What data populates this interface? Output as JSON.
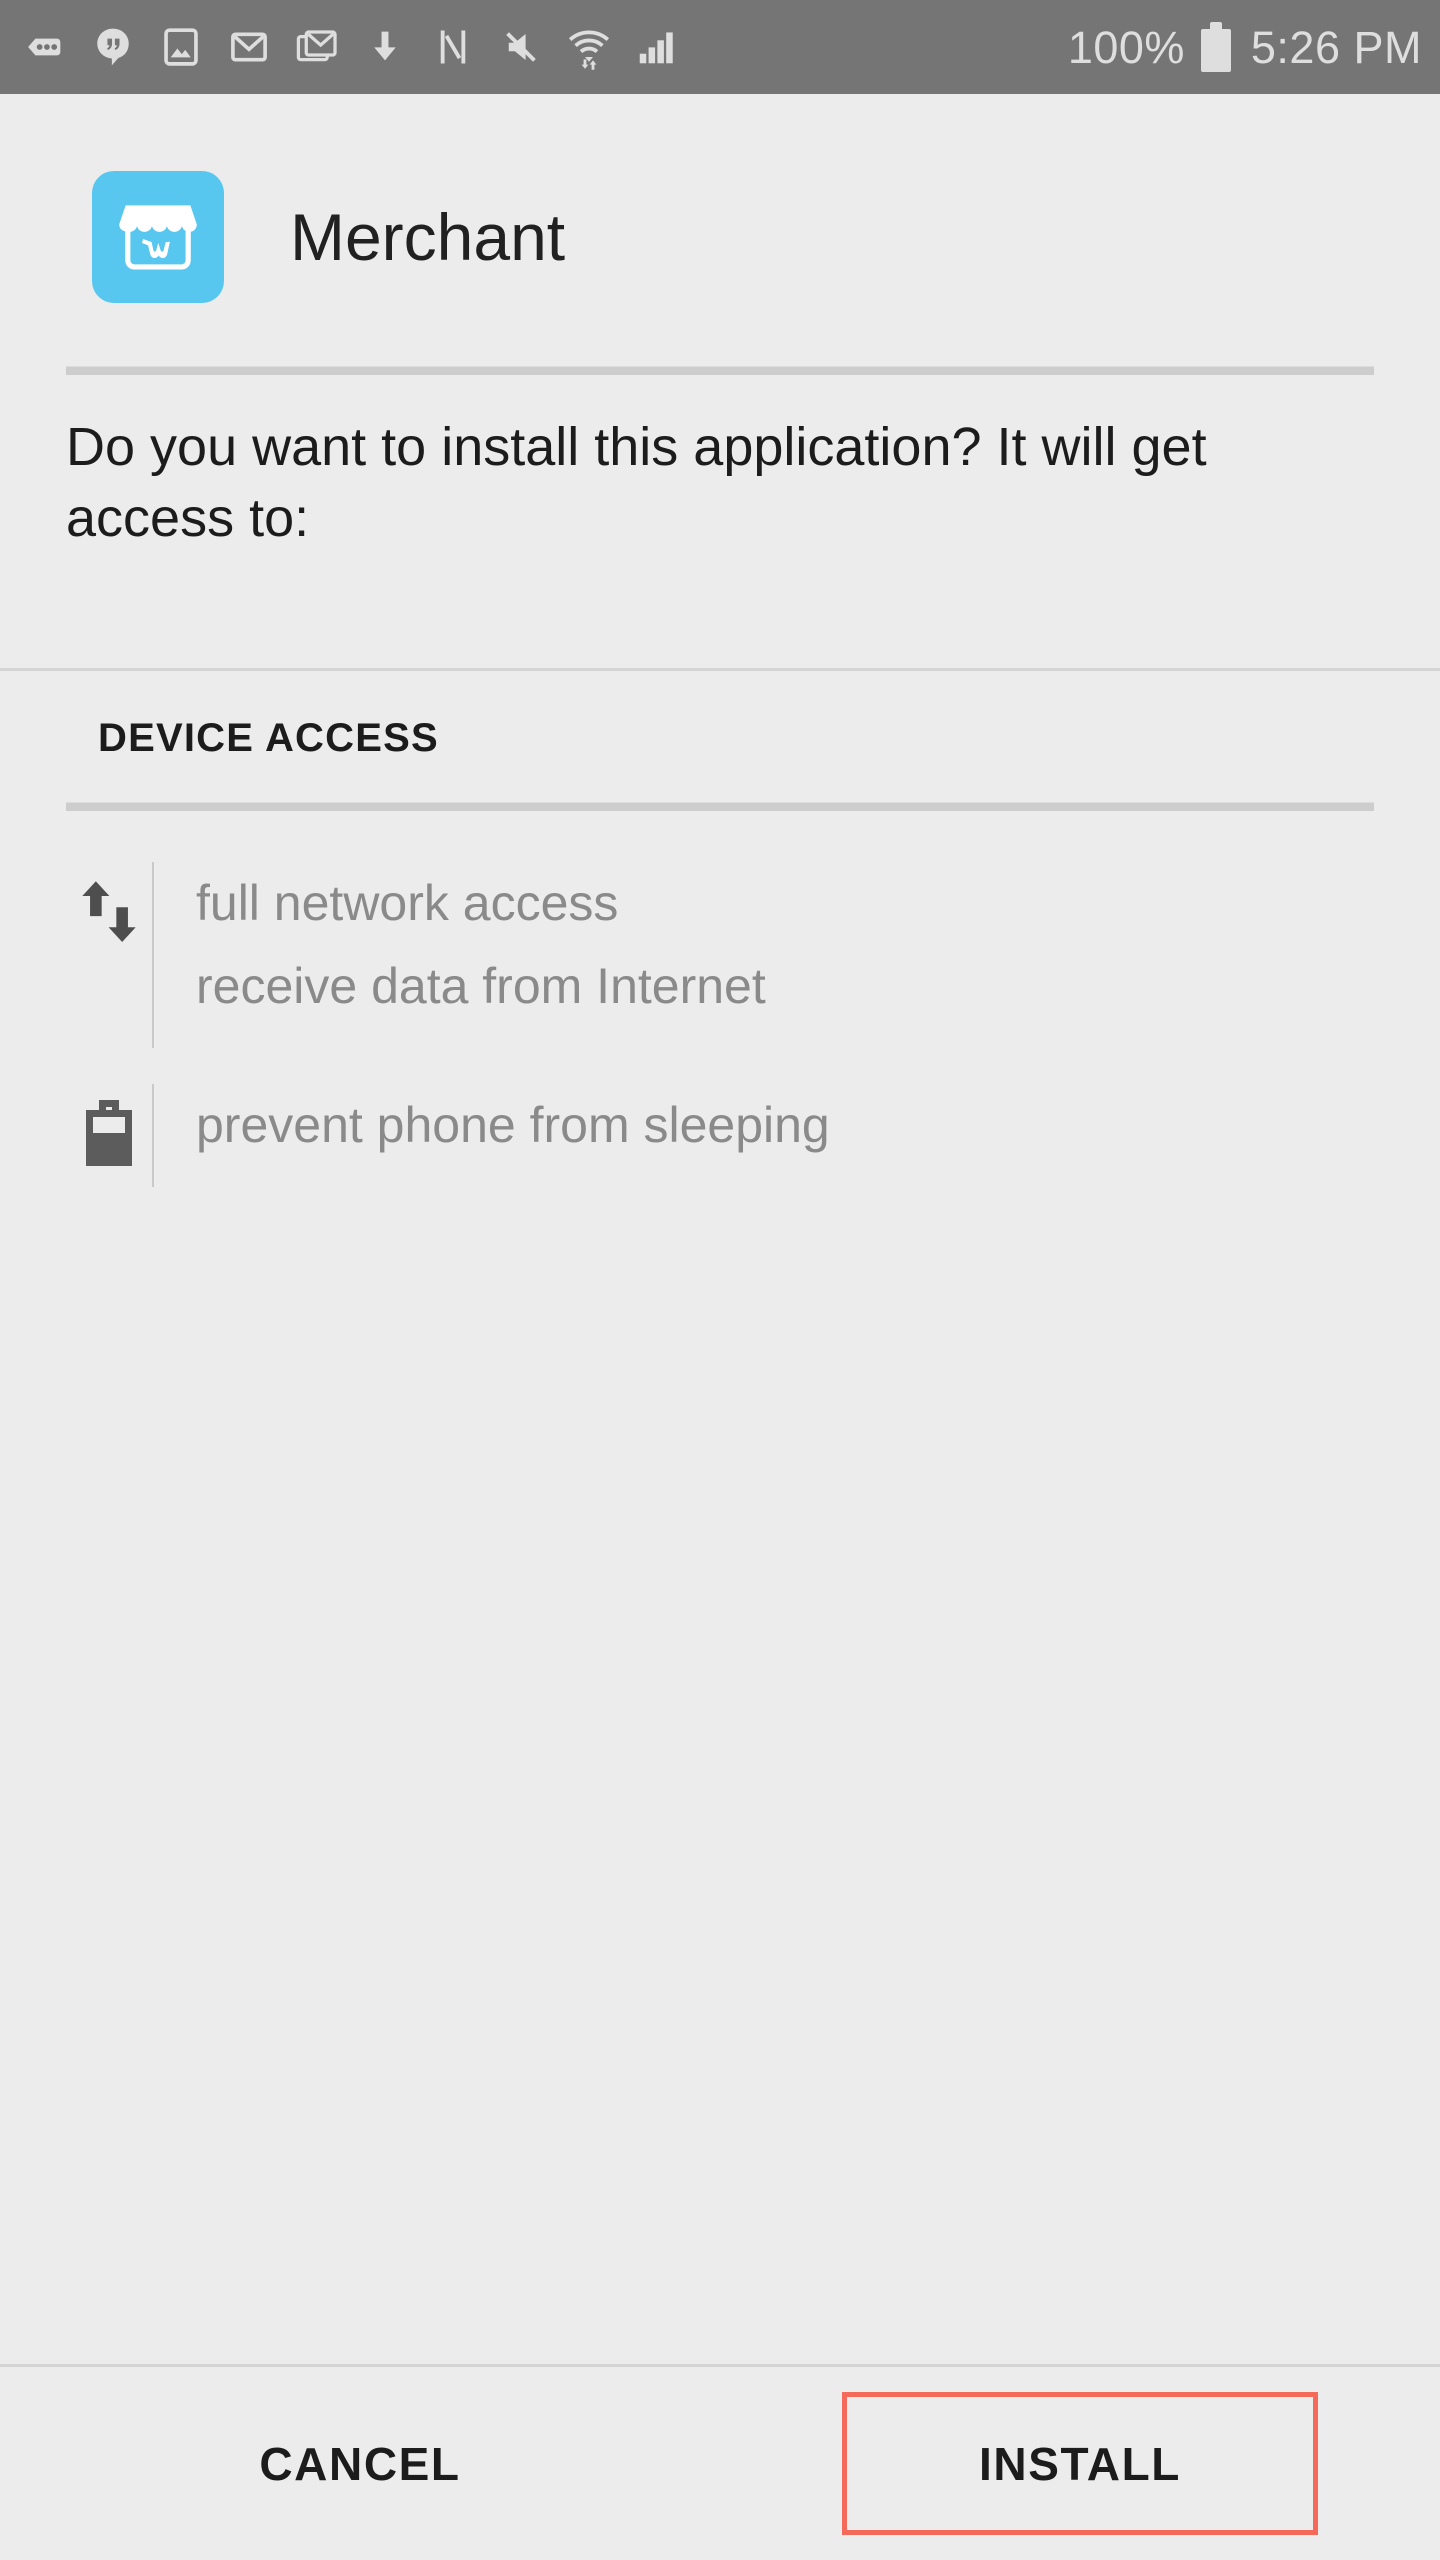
{
  "status_bar": {
    "background_color": "#757575",
    "foreground_color": "#dedede",
    "battery_percent": "100%",
    "clock": "5:26 PM",
    "left_icons": [
      "messages-dots-icon",
      "hangouts-icon",
      "photos-icon",
      "gmail-icon",
      "gmail-stacked-icon",
      "download-arrow-icon",
      "nfc-icon",
      "mute-icon",
      "wifi-icon",
      "cellular-signal-icon"
    ],
    "right_icons": [
      "battery-full-icon"
    ]
  },
  "app": {
    "name": "Merchant",
    "icon_name": "merchant-storefront-icon",
    "icon_background_color": "#57c7f0",
    "icon_foreground_color": "#ffffff"
  },
  "prompt": {
    "text": "Do you want to install this application? It will get access to:"
  },
  "device_access": {
    "section_title": "DEVICE ACCESS",
    "permissions": [
      {
        "icon_name": "network-data-arrows-icon",
        "lines": [
          "full network access",
          "receive data from Internet"
        ]
      },
      {
        "icon_name": "battery-wakelock-icon",
        "lines": [
          "prevent phone from sleeping"
        ]
      }
    ]
  },
  "footer": {
    "cancel_label": "CANCEL",
    "install_label": "INSTALL",
    "install_highlight_color": "#f4695a"
  }
}
